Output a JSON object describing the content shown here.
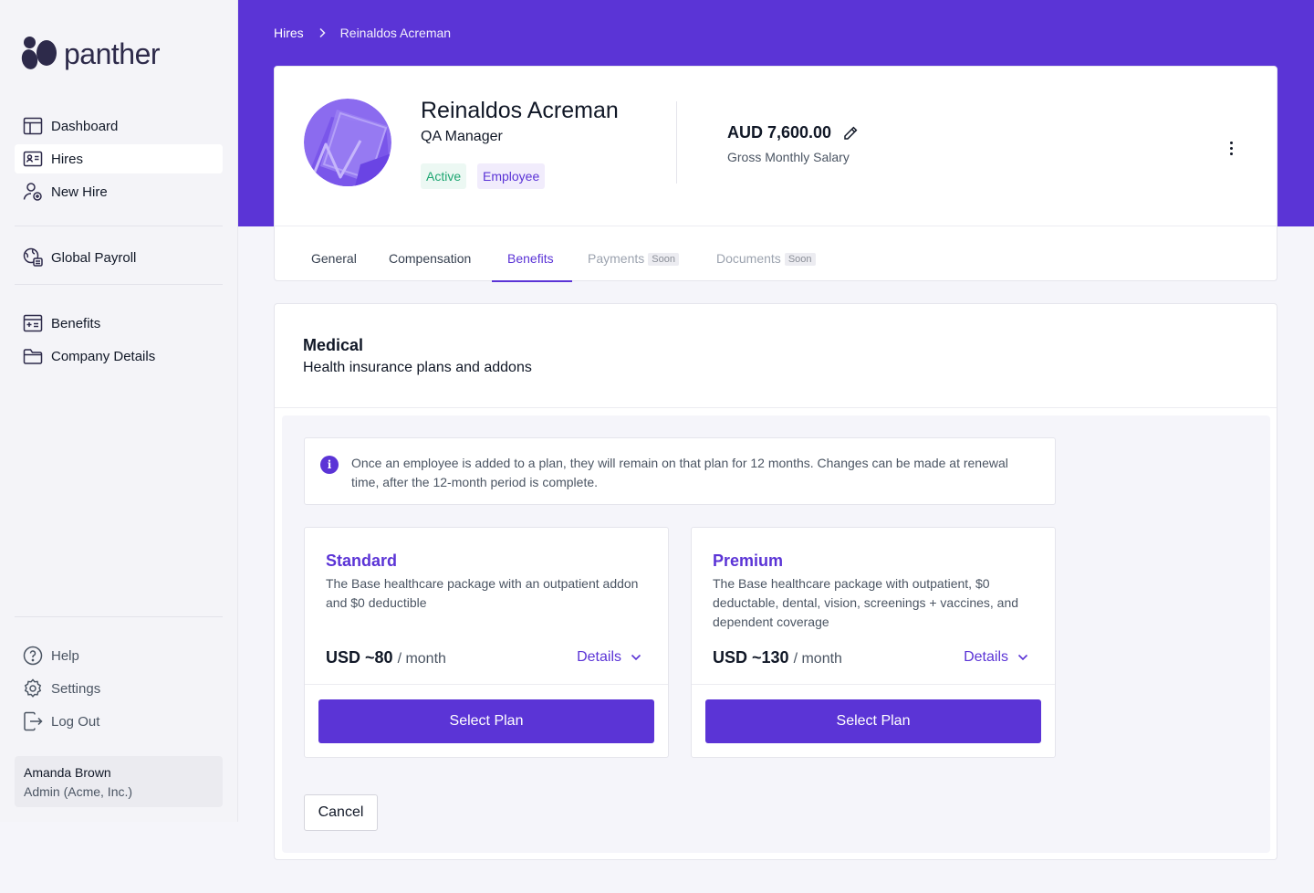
{
  "brand": {
    "name": "panther"
  },
  "sidebar": {
    "primary": [
      {
        "label": "Dashboard",
        "icon": "dashboard-icon"
      },
      {
        "label": "Hires",
        "icon": "id-card-icon",
        "active": true
      },
      {
        "label": "New Hire",
        "icon": "user-add-icon"
      }
    ],
    "payroll": [
      {
        "label": "Global Payroll",
        "icon": "global-payroll-icon"
      }
    ],
    "company": [
      {
        "label": "Benefits",
        "icon": "benefits-icon"
      },
      {
        "label": "Company Details",
        "icon": "folder-icon"
      }
    ],
    "footer": [
      {
        "label": "Help",
        "icon": "help-icon"
      },
      {
        "label": "Settings",
        "icon": "gear-icon"
      },
      {
        "label": "Log Out",
        "icon": "logout-icon"
      }
    ],
    "user": {
      "name": "Amanda Brown",
      "role": "Admin (Acme, Inc.)"
    }
  },
  "breadcrumb": {
    "parent": "Hires",
    "current": "Reinaldos Acreman"
  },
  "profile": {
    "name": "Reinaldos Acreman",
    "title": "QA Manager",
    "status_badge": "Active",
    "type_badge": "Employee",
    "salary": "AUD 7,600.00",
    "salary_label": "Gross Monthly Salary"
  },
  "tabs": [
    {
      "label": "General"
    },
    {
      "label": "Compensation"
    },
    {
      "label": "Benefits",
      "active": true
    },
    {
      "label": "Payments",
      "soon": "Soon"
    },
    {
      "label": "Documents",
      "soon": "Soon"
    }
  ],
  "medical": {
    "title": "Medical",
    "subtitle": "Health insurance plans and addons",
    "info": "Once an employee is added to a plan, they will remain on that plan for 12 months. Changes can be made at renewal time, after the 12-month period is complete.",
    "plans": [
      {
        "name": "Standard",
        "description": "The Base healthcare package with an outpatient addon and $0 deductible",
        "price": "USD ~80",
        "unit": "/ month",
        "details": "Details",
        "button": "Select Plan"
      },
      {
        "name": "Premium",
        "description": "The Base healthcare package with outpatient, $0 deductable, dental, vision, screenings + vaccines, and dependent coverage",
        "price": "USD ~130",
        "unit": "/ month",
        "details": "Details",
        "button": "Select Plan"
      }
    ],
    "cancel": "Cancel"
  },
  "colors": {
    "accent": "#5b34d6",
    "active_green": "#1ea672"
  }
}
